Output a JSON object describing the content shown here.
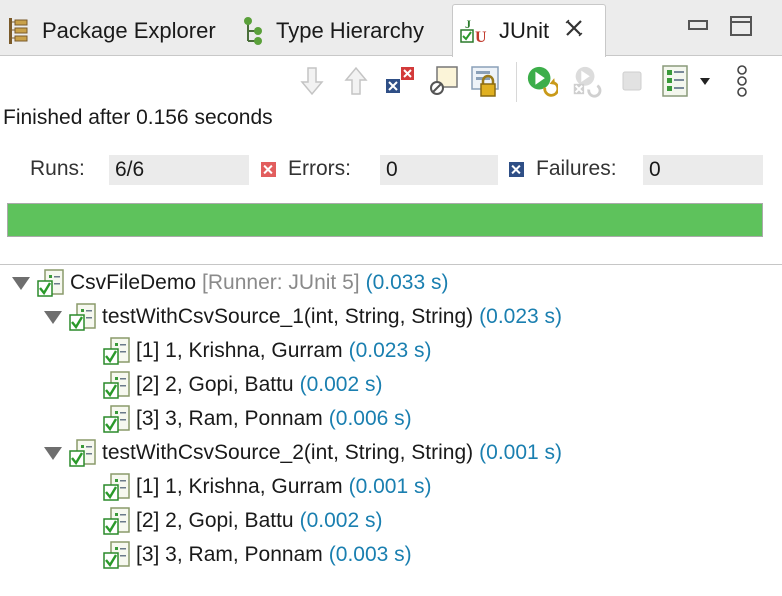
{
  "tabs": [
    {
      "label": "Package Explorer",
      "icon": "package-explorer-icon"
    },
    {
      "label": "Type Hierarchy",
      "icon": "type-hierarchy-icon"
    },
    {
      "label": "JUnit",
      "icon": "junit-icon",
      "active": true
    }
  ],
  "toolbar": {
    "items": [
      "next-failure-icon",
      "previous-failure-icon",
      "show-failures-only-icon",
      "show-skipped-only-icon",
      "scroll-lock-icon",
      "rerun-test-icon",
      "rerun-failed-first-icon",
      "stop-icon",
      "test-run-history-icon",
      "view-menu-icon"
    ]
  },
  "status": "Finished after 0.156 seconds",
  "counters": {
    "runs_label": "Runs:",
    "runs_value": "6/6",
    "errors_label": "Errors:",
    "errors_value": "0",
    "failures_label": "Failures:",
    "failures_value": "0"
  },
  "progress": {
    "fraction": 1.0,
    "color": "#5ec25c"
  },
  "colors": {
    "time": "#1a7fb0",
    "runner": "#8a8a8a"
  },
  "tree": {
    "root": {
      "name": "CsvFileDemo",
      "runner": "[Runner: JUnit 5]",
      "time": "(0.033 s)"
    },
    "methods": [
      {
        "name": "testWithCsvSource_1(int, String, String)",
        "time": "(0.023 s)",
        "cases": [
          {
            "name": "[1] 1, Krishna, Gurram",
            "time": "(0.023 s)"
          },
          {
            "name": "[2] 2, Gopi, Battu",
            "time": "(0.002 s)"
          },
          {
            "name": "[3] 3, Ram, Ponnam",
            "time": "(0.006 s)"
          }
        ]
      },
      {
        "name": "testWithCsvSource_2(int, String, String)",
        "time": "(0.001 s)",
        "cases": [
          {
            "name": "[1] 1, Krishna, Gurram",
            "time": "(0.001 s)"
          },
          {
            "name": "[2] 2, Gopi, Battu",
            "time": "(0.002 s)"
          },
          {
            "name": "[3] 3, Ram, Ponnam",
            "time": "(0.003 s)"
          }
        ]
      }
    ]
  }
}
